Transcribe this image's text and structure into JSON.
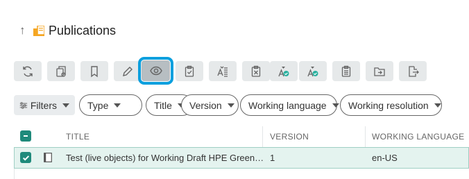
{
  "header": {
    "title": "Publications",
    "up_icon": "↑",
    "folder_icon": "publication-folder-icon"
  },
  "toolbar": {
    "buttons": [
      {
        "name": "refresh-button",
        "icon": "refresh-icon"
      },
      {
        "name": "copy-button",
        "icon": "copy-icon"
      },
      {
        "name": "bookmark-button",
        "icon": "bookmark-icon"
      },
      {
        "name": "edit-button",
        "icon": "pencil-icon"
      },
      {
        "name": "preview-button",
        "icon": "eye-icon",
        "active": true
      },
      {
        "name": "checklist-button",
        "icon": "clipboard-check-icon"
      },
      {
        "name": "language-button",
        "icon": "language-icon"
      },
      {
        "name": "delete-button",
        "icon": "clipboard-x-icon"
      },
      {
        "name": "release-button",
        "icon": "release-icon"
      },
      {
        "name": "approve-button",
        "icon": "approve-icon"
      },
      {
        "name": "report-button",
        "icon": "clipboard-list-icon"
      },
      {
        "name": "move-button",
        "icon": "folder-move-icon"
      },
      {
        "name": "export-button",
        "icon": "export-icon"
      }
    ]
  },
  "filters": {
    "filters_label": "Filters",
    "pills": [
      "Type",
      "Title",
      "Version",
      "Working language",
      "Working resolution"
    ]
  },
  "table": {
    "columns": [
      "TITLE",
      "VERSION",
      "WORKING LANGUAGE"
    ],
    "rows": [
      {
        "title": "Test (live objects) for Working Draft HPE Green…",
        "version": "1",
        "language": "en-US",
        "selected": true
      }
    ]
  },
  "colors": {
    "accent": "#0a9fde",
    "check": "#1f8a7b",
    "row_selected": "#e4f3ef"
  }
}
